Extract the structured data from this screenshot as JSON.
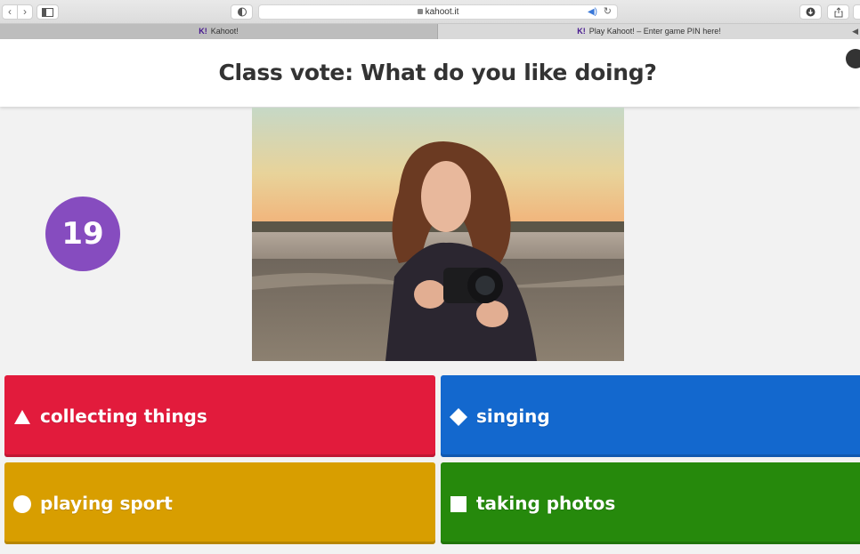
{
  "browser": {
    "url": "kahoot.it",
    "tabs": [
      {
        "logo": "K!",
        "title": "Kahoot!"
      },
      {
        "logo": "K!",
        "title": "Play Kahoot! – Enter game PIN here!"
      }
    ]
  },
  "question": {
    "title": "Class vote: What do you like doing?",
    "timer": "19"
  },
  "answers": [
    {
      "label": "collecting things",
      "shape": "triangle-icon",
      "color": "#e21b3c"
    },
    {
      "label": "singing",
      "shape": "diamond-icon",
      "color": "#1368ce"
    },
    {
      "label": "playing sport",
      "shape": "circle-icon",
      "color": "#d89e00"
    },
    {
      "label": "taking photos",
      "shape": "square-icon",
      "color": "#26890c"
    }
  ],
  "colors": {
    "timer": "#864cbf"
  }
}
